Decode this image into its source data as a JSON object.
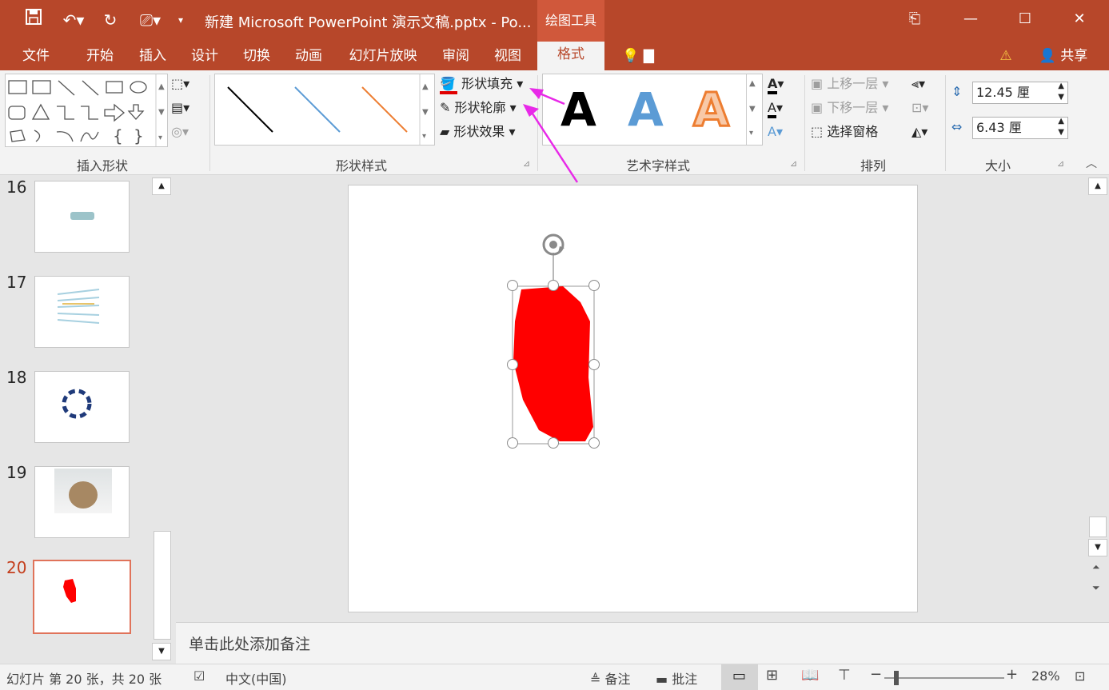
{
  "window": {
    "title": "新建 Microsoft PowerPoint 演示文稿.pptx - Po...",
    "context_tab": "绘图工具",
    "share_label": "共享"
  },
  "tabs": [
    "文件",
    "开始",
    "插入",
    "设计",
    "切换",
    "动画",
    "幻灯片放映",
    "审阅",
    "视图",
    "格式"
  ],
  "active_tab": "格式",
  "ribbon": {
    "insert_shapes": {
      "label": "插入形状"
    },
    "shape_styles": {
      "label": "形状样式",
      "fill": "形状填充",
      "outline": "形状轮廓",
      "effects": "形状效果"
    },
    "wordart": {
      "label": "艺术字样式",
      "sample": "A"
    },
    "arrange": {
      "label": "排列",
      "bring_forward": "上移一层",
      "send_backward": "下移一层",
      "selection_pane": "选择窗格"
    },
    "size": {
      "label": "大小",
      "height": "12.45 厘",
      "width": "6.43 厘"
    }
  },
  "thumbnails": [
    {
      "num": "16"
    },
    {
      "num": "17"
    },
    {
      "num": "18"
    },
    {
      "num": "19"
    },
    {
      "num": "20"
    }
  ],
  "selected_slide": "20",
  "notes_placeholder": "单击此处添加备注",
  "status": {
    "slide_info": "幻灯片 第 20 张，共 20 张",
    "language": "中文(中国)",
    "notes": "备注",
    "comments": "批注",
    "zoom": "28%"
  },
  "colors": {
    "accent": "#b7472a",
    "shape_fill": "#ff0000",
    "annotation_arrow": "#e829e8"
  }
}
